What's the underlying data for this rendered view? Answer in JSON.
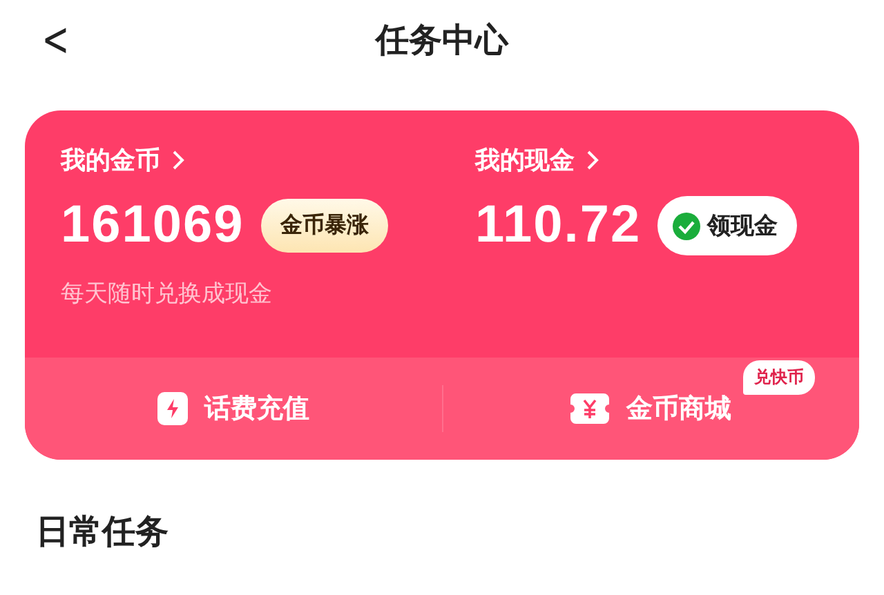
{
  "header": {
    "back": "<",
    "title": "任务中心"
  },
  "wallet": {
    "coins": {
      "label": "我的金币",
      "value": "161069",
      "badge": "金币暴涨"
    },
    "cash": {
      "label": "我的现金",
      "value": "110.72",
      "button": "领现金"
    },
    "note": "每天随时兑换成现金"
  },
  "shortcuts": [
    {
      "kind": "phone",
      "label": "话费充值"
    },
    {
      "kind": "mall",
      "label": "金币商城",
      "tag": "兑快币"
    }
  ],
  "section": {
    "title": "日常任务"
  }
}
